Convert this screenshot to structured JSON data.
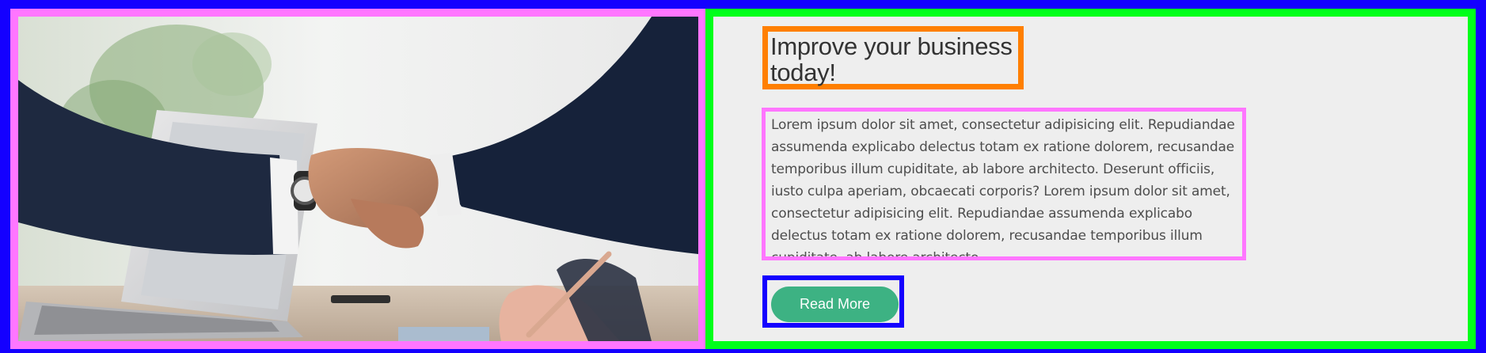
{
  "hero": {
    "image_alt": "Business handshake over laptop",
    "headline": "Improve your business today!",
    "body": "Lorem ipsum dolor sit amet, consectetur adipisicing elit. Repudiandae assumenda explicabo delectus totam ex ratione dolorem, recusandae temporibus illum cupiditate, ab labore architecto. Deserunt officiis, iusto culpa aperiam, obcaecati corporis? Lorem ipsum dolor sit amet, consectetur adipisicing elit. Repudiandae assumenda explicabo delectus totam ex ratione dolorem, recusandae temporibus illum cupiditate, ab labore architecto.",
    "button_label": "Read More"
  },
  "colors": {
    "outer_border": "#1400ff",
    "image_frame": "#ff76ff",
    "content_frame": "#00ff1a",
    "headline_frame": "#ff7f00",
    "body_frame": "#ff76ff",
    "button_frame": "#1400ff",
    "button_bg": "#3db283",
    "panel_bg": "#eeeeee"
  }
}
